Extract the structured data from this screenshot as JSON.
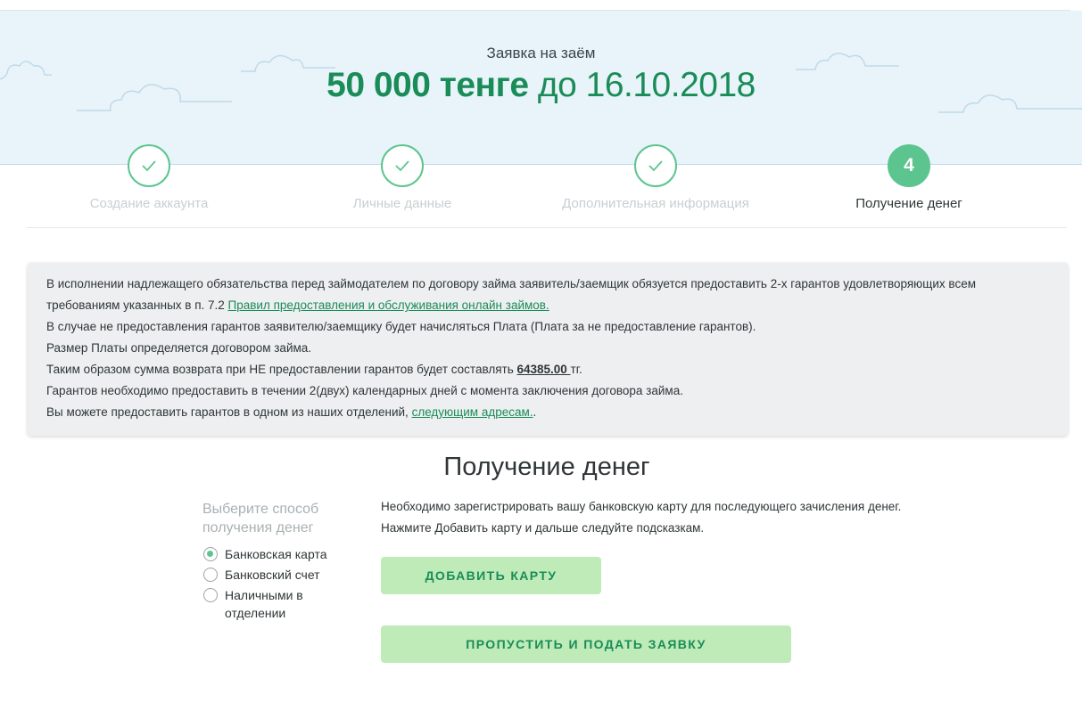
{
  "header": {
    "subtitle": "Заявка на заём",
    "amount": "50 000 тенге",
    "date_text": "до 16.10.2018"
  },
  "steps": [
    {
      "label": "Создание аккаунта",
      "state": "done",
      "icon": "check-icon"
    },
    {
      "label": "Личные данные",
      "state": "done",
      "icon": "check-icon"
    },
    {
      "label": "Дополнительная информация",
      "state": "done",
      "icon": "check-icon"
    },
    {
      "label": "Получение денег",
      "state": "active",
      "number": "4"
    }
  ],
  "notice": {
    "line1": "В исполнении надлежащего обязательства перед займодателем по договору займа заявитель/заемщик обязуется предоставить 2-х гарантов удовлетворяющих всем",
    "line2_prefix": "требованиям указанных в п. 7.2 ",
    "line2_link": "Правил предоставления и обслуживания онлайн займов.",
    "line3": "В случае не предоставления гарантов заявителю/заемщику будет начисляться Плата (Плата за не предоставление гарантов).",
    "line4": "Размер Платы определяется договором займа.",
    "line5_prefix": "Таким образом сумма возврата при НЕ предоставлении гарантов будет составлять ",
    "line5_sum": "64385.00 ",
    "line5_suffix": "тг.",
    "line6": "Гарантов необходимо предоставить в течении 2(двух) календарных дней с момента заключения договора займа.",
    "line7_prefix": "Вы можете предоставить гарантов в одном из наших отделений, ",
    "line7_link": "следующим адресам.",
    "line7_suffix": "."
  },
  "section": {
    "title": "Получение денег",
    "method_label": "Выберите способ получения денег",
    "options": [
      {
        "label": "Банковская карта",
        "checked": true
      },
      {
        "label": "Банковский счет",
        "checked": false
      },
      {
        "label": "Наличными в отделении",
        "checked": false
      }
    ],
    "info_line1": "Необходимо зарегистрировать вашу банковскую карту для последующего зачисления денег.",
    "info_line2": "Нажмите Добавить карту и дальше следуйте подсказкам.",
    "add_card_button": "ДОБАВИТЬ КАРТУ",
    "skip_button": "ПРОПУСТИТЬ И ПОДАТЬ ЗАЯВКУ"
  },
  "colors": {
    "brand_green": "#1a8c58",
    "step_green": "#5cc58f",
    "button_bg": "#bfebb8",
    "hero_bg": "#e8f4fa"
  }
}
